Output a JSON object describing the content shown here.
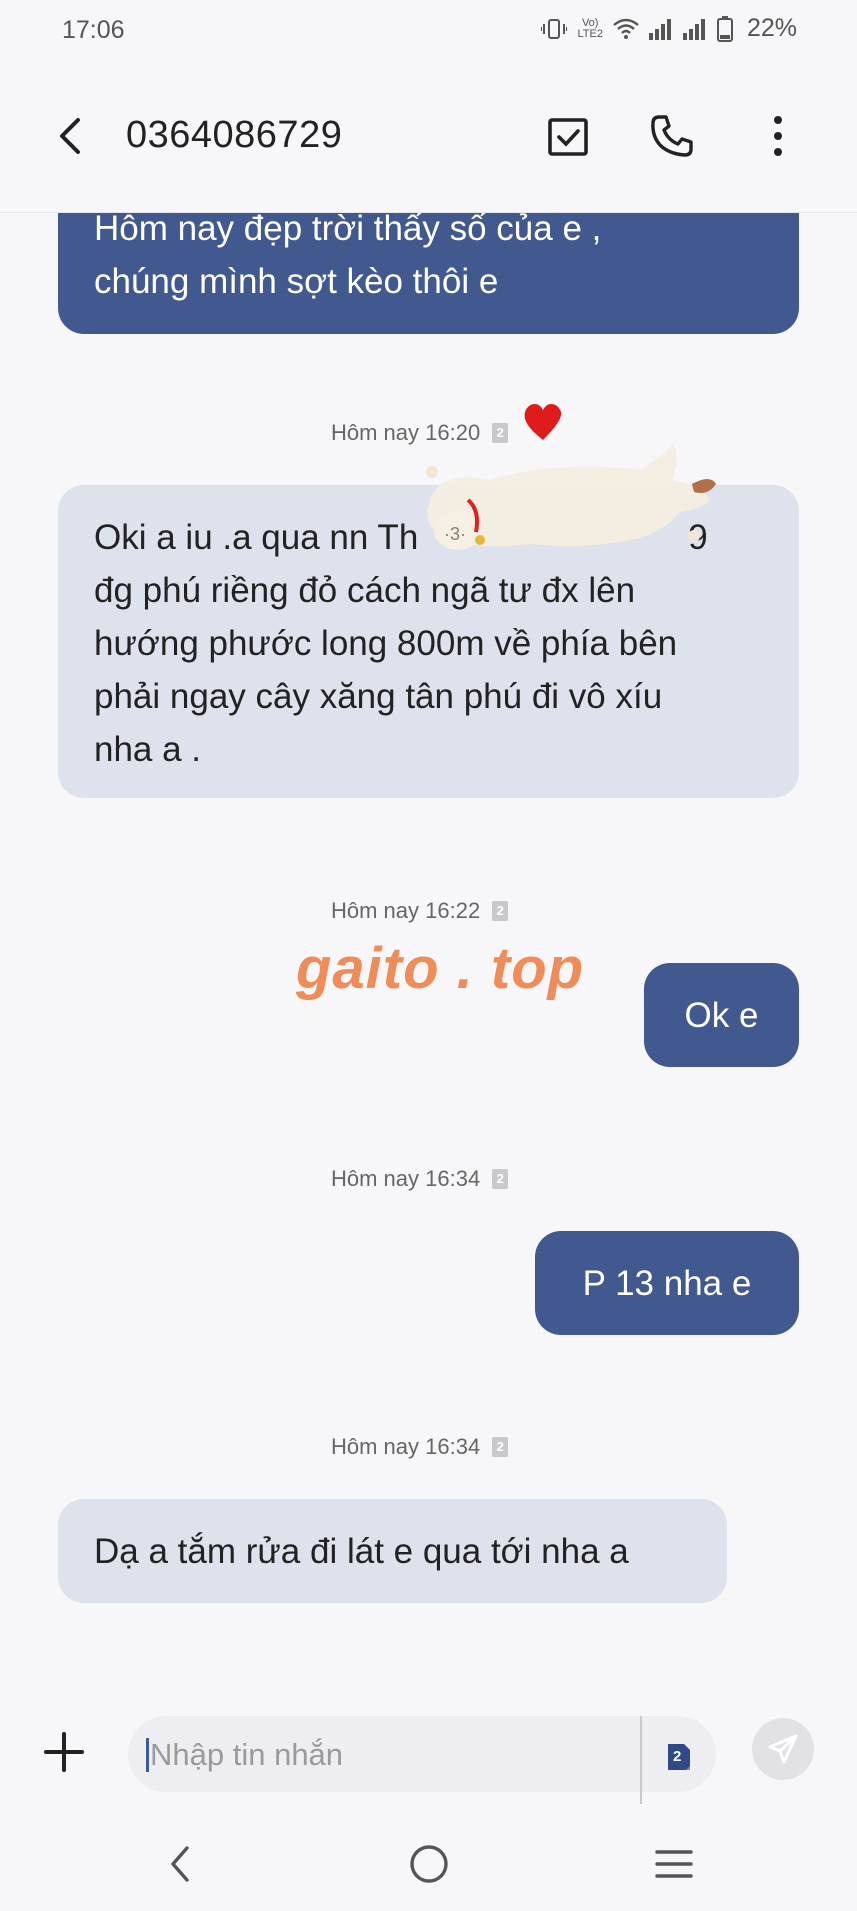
{
  "status_bar": {
    "time": "17:06",
    "battery": "22%",
    "network_label": "LTE2"
  },
  "header": {
    "contact": "0364086729",
    "icons": [
      "back-arrow-icon",
      "select-check-icon",
      "phone-icon",
      "more-vert-icon"
    ]
  },
  "messages": [
    {
      "type": "out",
      "text_line1": "Hôm nay đẹp trời thấy số của e ,",
      "text_line2": "chúng mình sợt kèo thôi e"
    },
    {
      "type": "timestamp",
      "text": "Hôm nay 16:20",
      "sim": "2"
    },
    {
      "type": "in",
      "lines": [
        "Oki a iu .a qua nn Th",
        "đg phú riềng đỏ cách ngã tư đx lên",
        "hướng phước long 800m về phía bên",
        "phải ngay cây xăng tân phú đi vô xíu",
        "nha a ."
      ],
      "partial_suffix": "9"
    },
    {
      "type": "timestamp",
      "text": "Hôm nay 16:22",
      "sim": "2"
    },
    {
      "type": "out",
      "text": "Ok e"
    },
    {
      "type": "timestamp",
      "text": "Hôm nay 16:34",
      "sim": "2"
    },
    {
      "type": "out",
      "text": "P 13 nha e"
    },
    {
      "type": "timestamp",
      "text": "Hôm nay 16:34",
      "sim": "2"
    },
    {
      "type": "in",
      "text": "Dạ a tắm rửa đi lát e qua tới nha a"
    }
  ],
  "watermark": "gaito . top",
  "compose": {
    "placeholder": "Nhập tin nhắn",
    "sim": "2"
  },
  "colors": {
    "outgoing_bubble": "#41598f",
    "incoming_bubble": "#dde2ec",
    "background": "#f7f7f9",
    "watermark": "#f08b5a",
    "heart": "#e01b1b"
  }
}
